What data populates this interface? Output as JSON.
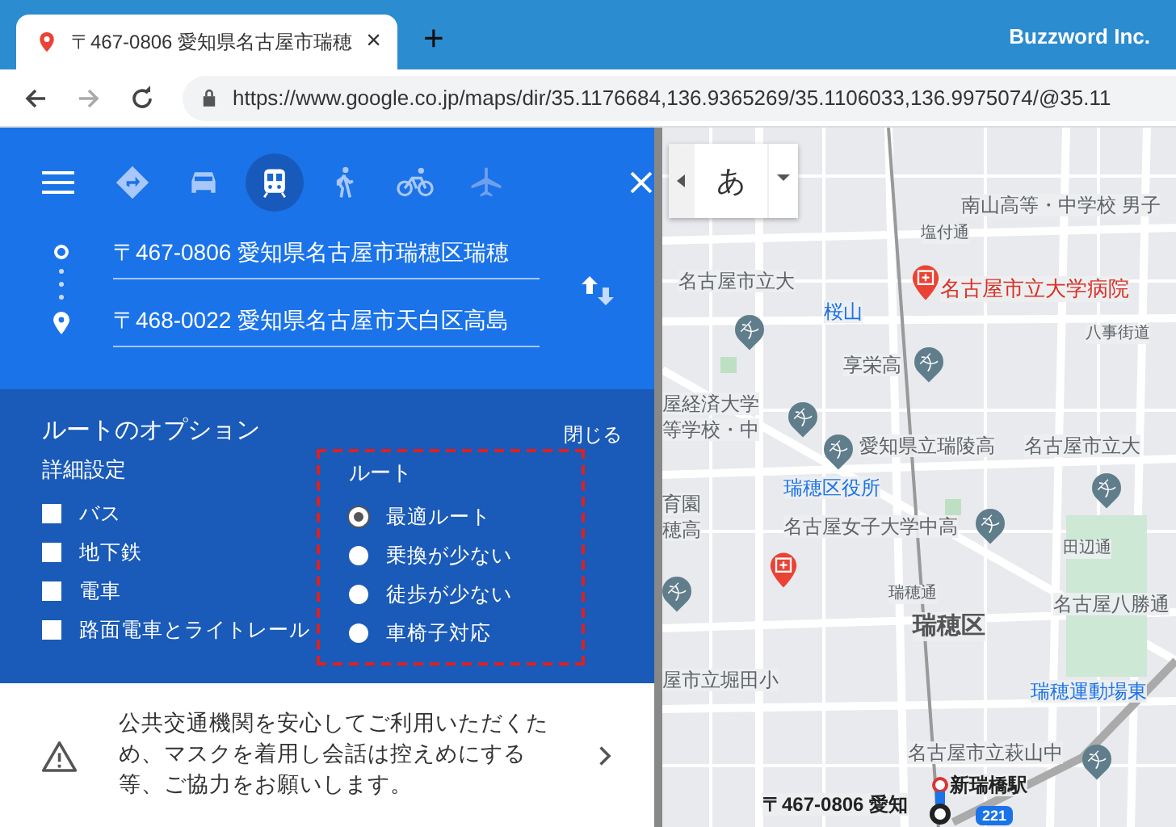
{
  "browser": {
    "tab": {
      "title": "〒467-0806 愛知県名古屋市瑞穂",
      "close": "×"
    },
    "new_tab": "+",
    "profile": "Buzzword Inc.",
    "url": "https://www.google.co.jp/maps/dir/35.1176684,136.9365269/35.1106033,136.9975074/@35.11"
  },
  "travel_modes": [
    {
      "kind": "best",
      "selected": false
    },
    {
      "kind": "car",
      "selected": false
    },
    {
      "kind": "transit",
      "selected": true
    },
    {
      "kind": "walk",
      "selected": false
    },
    {
      "kind": "bike",
      "selected": false
    },
    {
      "kind": "flight",
      "selected": false
    }
  ],
  "directions": {
    "origin": "〒467-0806 愛知県名古屋市瑞穂区瑞穂",
    "destination": "〒468-0022 愛知県名古屋市天白区高島"
  },
  "route_options": {
    "title": "ルートのオプション",
    "close": "閉じる",
    "advanced": {
      "heading": "詳細設定",
      "items": [
        {
          "label": "バス",
          "checked": false
        },
        {
          "label": "地下鉄",
          "checked": false
        },
        {
          "label": "電車",
          "checked": false
        },
        {
          "label": "路面電車とライトレール",
          "checked": false
        }
      ]
    },
    "route": {
      "heading": "ルート",
      "highlighted": true,
      "items": [
        {
          "label": "最適ルート",
          "selected": true
        },
        {
          "label": "乗換が少ない",
          "selected": false
        },
        {
          "label": "徒歩が少ない",
          "selected": false
        },
        {
          "label": "車椅子対応",
          "selected": false
        }
      ]
    }
  },
  "notice": {
    "text": "公共交通機関を安心してご利用いただくため、マスクを着用し会話は控えめにする等、ご協力をお願いします。"
  },
  "map": {
    "ime_key": "あ",
    "labels": [
      {
        "text": "南山高等・中学校 男子",
        "kind": "place"
      },
      {
        "text": "塩付通",
        "kind": "street"
      },
      {
        "text": "名古屋市立大",
        "kind": "place"
      },
      {
        "text": "名古屋市立大学病院",
        "kind": "hospital"
      },
      {
        "text": "桜山",
        "kind": "station"
      },
      {
        "text": "享栄高",
        "kind": "place"
      },
      {
        "text": "八事街道",
        "kind": "street"
      },
      {
        "text": "屋経済大学",
        "kind": "place"
      },
      {
        "text": "等学校・中",
        "kind": "place"
      },
      {
        "text": "愛知県立瑞陵高",
        "kind": "place"
      },
      {
        "text": "名古屋市立大",
        "kind": "place"
      },
      {
        "text": "瑞穂区役所",
        "kind": "station"
      },
      {
        "text": "育園",
        "kind": "place"
      },
      {
        "text": "穂高",
        "kind": "place"
      },
      {
        "text": "名古屋女子大学中高",
        "kind": "place"
      },
      {
        "text": "田辺通",
        "kind": "street"
      },
      {
        "text": "瑞穂通",
        "kind": "street"
      },
      {
        "text": "名古屋八勝通",
        "kind": "place"
      },
      {
        "text": "瑞穂区",
        "kind": "district"
      },
      {
        "text": "屋市立堀田小",
        "kind": "place"
      },
      {
        "text": "瑞穂運動場東",
        "kind": "station"
      },
      {
        "text": "名古屋市立萩山中",
        "kind": "place"
      },
      {
        "text": "新瑞橋駅",
        "kind": "route"
      },
      {
        "text": "〒467-0806 愛知",
        "kind": "route"
      }
    ],
    "school_pins": [
      "文",
      "文",
      "文",
      "文",
      "文",
      "文",
      "文",
      "文"
    ],
    "road_shield": "221"
  }
}
